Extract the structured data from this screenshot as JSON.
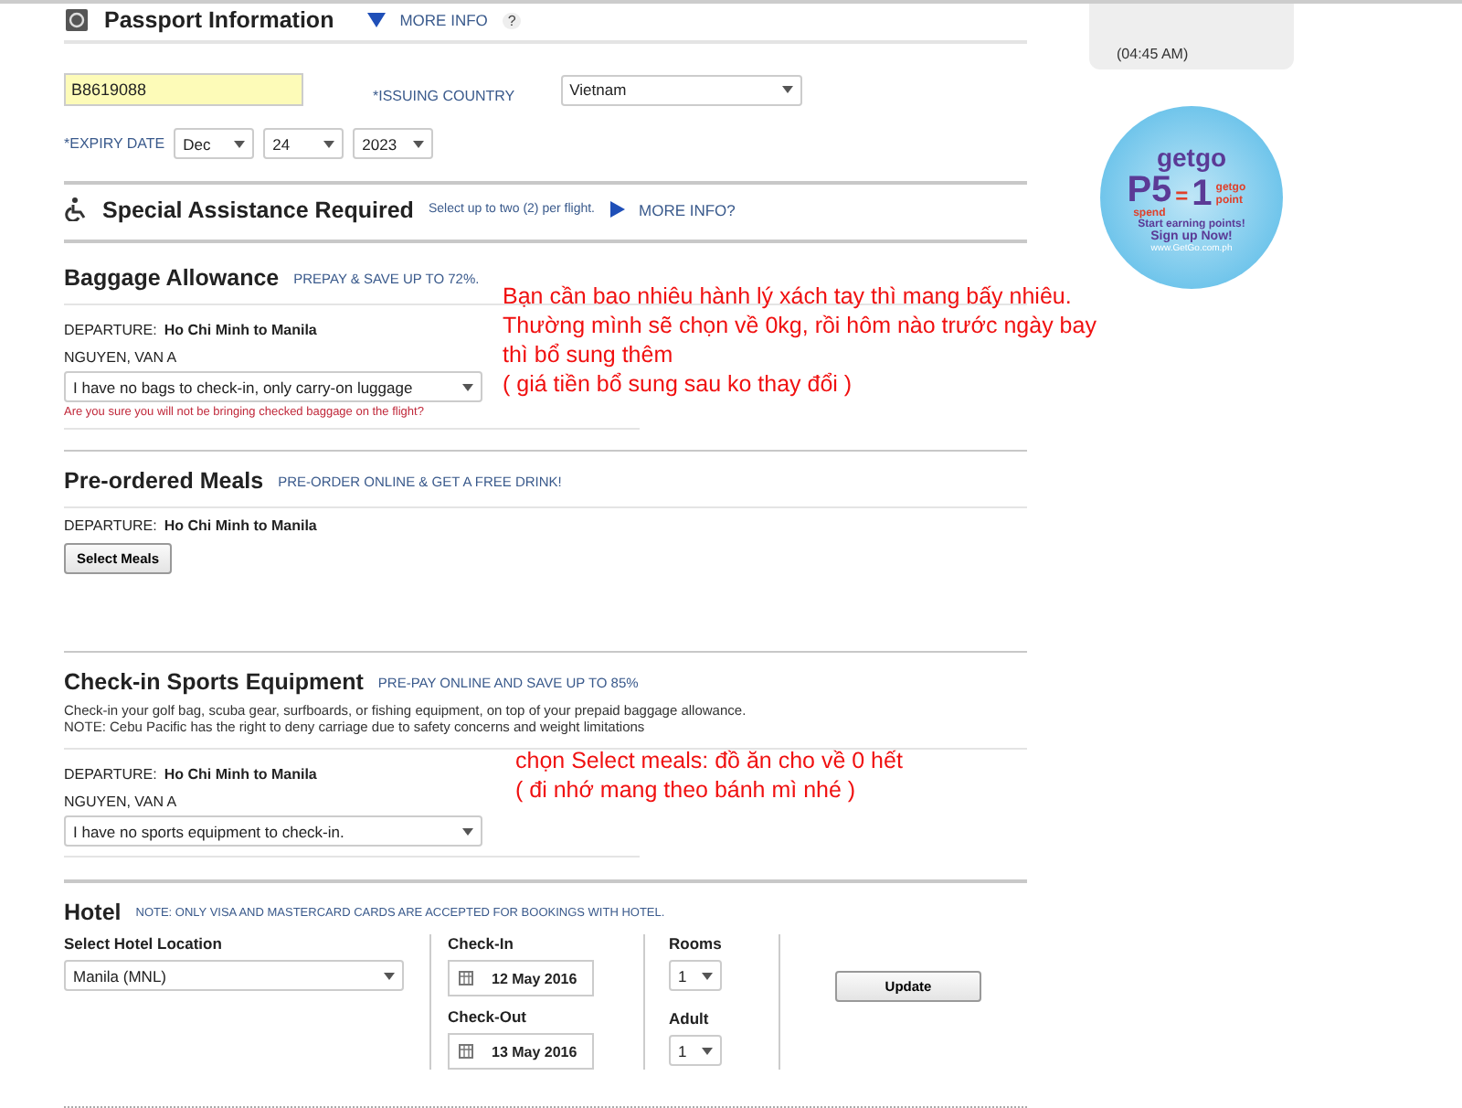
{
  "passport": {
    "title": "Passport Information",
    "more_info": "MORE INFO",
    "help": "?",
    "number": "B8619088",
    "issuing_country_label": "*ISSUING COUNTRY",
    "issuing_country": "Vietnam",
    "expiry_label": "*EXPIRY DATE",
    "expiry_month": "Dec",
    "expiry_day": "24",
    "expiry_year": "2023"
  },
  "special_assistance": {
    "title": "Special Assistance Required",
    "hint": "Select up to two (2) per flight.",
    "more_info": "MORE INFO?"
  },
  "baggage": {
    "title": "Baggage Allowance",
    "tagline": "PREPAY & SAVE UP TO 72%.",
    "departure_label": "DEPARTURE:",
    "route": "Ho Chi Minh  to  Manila",
    "passenger": "NGUYEN, VAN A",
    "selection": "I have no bags to check-in, only carry-on luggage",
    "warning": "Are you sure you will not be bringing checked baggage on the flight?"
  },
  "meals": {
    "title": "Pre-ordered Meals",
    "tagline": "PRE-ORDER ONLINE & GET A FREE DRINK!",
    "departure_label": "DEPARTURE:",
    "route": "Ho Chi Minh  to  Manila",
    "button": "Select Meals"
  },
  "sports": {
    "title": "Check-in Sports Equipment",
    "tagline": "PRE-PAY ONLINE AND SAVE UP TO 85%",
    "description": "Check-in your golf bag, scuba gear, surfboards, or fishing equipment, on top of your prepaid baggage allowance.",
    "note": "NOTE: Cebu Pacific has the right to deny carriage due to safety concerns and weight limitations",
    "departure_label": "DEPARTURE:",
    "route": "Ho Chi Minh  to  Manila",
    "passenger": "NGUYEN, VAN A",
    "selection": "I have no sports equipment to check-in."
  },
  "hotel": {
    "title": "Hotel",
    "note": "NOTE: ONLY VISA AND MASTERCARD CARDS ARE ACCEPTED FOR BOOKINGS WITH HOTEL.",
    "location_label": "Select Hotel Location",
    "location": "Manila (MNL)",
    "check_in_label": "Check-In",
    "check_in": "12 May 2016",
    "check_out_label": "Check-Out",
    "check_out": "13 May 2016",
    "rooms_label": "Rooms",
    "rooms": "1",
    "adult_label": "Adult",
    "adult": "1",
    "button": "Update"
  },
  "sidebar": {
    "time": "(04:45 AM)",
    "promo": {
      "brand": "getgo",
      "amount": "P5",
      "spend": "spend",
      "equals": "=",
      "points": "1",
      "points_label": "getgo point",
      "cta": "Start earning points!",
      "signup": "Sign up Now!",
      "url": "www.GetGo.com.ph"
    }
  },
  "annotations": [
    {
      "text": "Bạn cần bao nhiêu hành lý xách tay thì mang bấy nhiêu. Thường mình sẽ chọn về 0kg, rồi hôm nào trước ngày bay thì bổ sung thêm\n( giá tiền bổ sung sau ko thay đổi )"
    },
    {
      "text": "chọn Select meals: đồ ăn cho về 0 hết\n( đi nhớ mang theo bánh mì nhé )"
    }
  ]
}
